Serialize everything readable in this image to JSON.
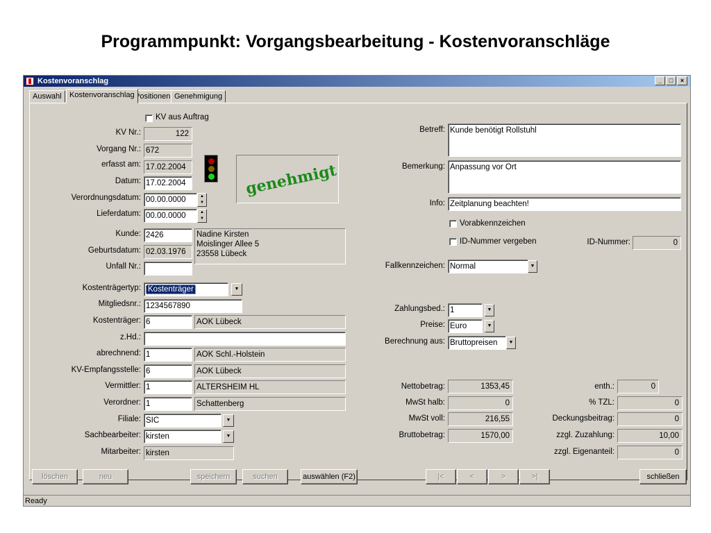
{
  "slide": {
    "title": "Programmpunkt: Vorgangsbearbeitung - Kostenvoranschläge"
  },
  "window": {
    "title": "Kostenvoranschlag",
    "min": "_",
    "max": "□",
    "close": "×"
  },
  "tabs": [
    {
      "label": "Auswahl"
    },
    {
      "label": "Kostenvoranschlag"
    },
    {
      "label": "Positionen"
    },
    {
      "label": "Genehmigung"
    }
  ],
  "left": {
    "kv_aus_auftrag": "KV aus Auftrag",
    "kv_nr": {
      "label": "KV Nr.:",
      "value": "122"
    },
    "vorgang_nr": {
      "label": "Vorgang Nr.:",
      "value": "672"
    },
    "erfasst_am": {
      "label": "erfasst am:",
      "value": "17.02.2004"
    },
    "datum": {
      "label": "Datum:",
      "value": "17.02.2004"
    },
    "verordnungsdatum": {
      "label": "Verordnungsdatum:",
      "value": "00.00.0000"
    },
    "lieferdatum": {
      "label": "Lieferdatum:",
      "value": "00.00.0000"
    },
    "kunde": {
      "label": "Kunde:",
      "value": "2426",
      "name": "Nadine Kirsten",
      "street": "Moislinger Allee 5",
      "city": "23558 Lübeck"
    },
    "geburtsdatum": {
      "label": "Geburtsdatum:",
      "value": "02.03.1976"
    },
    "unfall_nr": {
      "label": "Unfall Nr.:",
      "value": ""
    },
    "kostentraegertyp": {
      "label": "Kostenträgertyp:",
      "value": "Kostenträger"
    },
    "mitgliedsnr": {
      "label": "Mitgliedsnr.:",
      "value": "1234567890"
    },
    "kostentraeger": {
      "label": "Kostenträger:",
      "value": "6",
      "name": "AOK Lübeck"
    },
    "zhd": {
      "label": "z.Hd.:",
      "value": ""
    },
    "abrechnend": {
      "label": "abrechnend:",
      "value": "1",
      "name": "AOK Schl.-Holstein"
    },
    "kv_empfangsstelle": {
      "label": "KV-Empfangsstelle:",
      "value": "6",
      "name": "AOK Lübeck"
    },
    "vermittler": {
      "label": "Vermittler:",
      "value": "1",
      "name": "ALTERSHEIM HL"
    },
    "verordner": {
      "label": "Verordner:",
      "value": "1",
      "name": "Schattenberg"
    },
    "filiale": {
      "label": "Filiale:",
      "value": "SIC"
    },
    "sachbearbeiter": {
      "label": "Sachbearbeiter:",
      "value": "kirsten"
    },
    "mitarbeiter": {
      "label": "Mitarbeiter:",
      "value": "kirsten"
    }
  },
  "status_stamp": "genehmigt",
  "right": {
    "betreff": {
      "label": "Betreff:",
      "value": "Kunde benötigt Rollstuhl"
    },
    "bemerkung": {
      "label": "Bemerkung:",
      "value": "Anpassung vor Ort"
    },
    "info": {
      "label": "Info:",
      "value": "Zeitplanung beachten!"
    },
    "vorabkennzeichen": "Vorabkennzeichen",
    "id_nummer_vergeben": "ID-Nummer vergeben",
    "id_nummer": {
      "label": "ID-Nummer:",
      "value": "0"
    },
    "fallkennzeichen": {
      "label": "Fallkennzeichen:",
      "value": "Normal"
    },
    "zahlungsbed": {
      "label": "Zahlungsbed.:",
      "value": "1"
    },
    "preise": {
      "label": "Preise:",
      "value": "Euro"
    },
    "berechnung_aus": {
      "label": "Berechnung aus:",
      "value": "Bruttopreisen"
    },
    "nettobetrag": {
      "label": "Nettobetrag:",
      "value": "1353,45"
    },
    "mwst_halb": {
      "label": "MwSt halb:",
      "value": "0"
    },
    "mwst_voll": {
      "label": "MwSt voll:",
      "value": "216,55"
    },
    "bruttobetrag": {
      "label": "Bruttobetrag:",
      "value": "1570,00"
    },
    "enth": {
      "label": "enth.:",
      "value": "0"
    },
    "tzl": {
      "label": "% TZL:",
      "value": "0"
    },
    "deckungsbeitrag": {
      "label": "Deckungsbeitrag:",
      "value": "0"
    },
    "zzgl_zuzahlung": {
      "label": "zzgl. Zuzahlung:",
      "value": "10,00"
    },
    "zzgl_eigenanteil": {
      "label": "zzgl. Eigenanteil:",
      "value": "0"
    }
  },
  "buttons": {
    "loeschen": "löschen",
    "neu": "neu",
    "speichern": "speichern",
    "suchen": "suchen",
    "auswaehlen": "auswählen (F2)",
    "first": "|<",
    "prev": "<",
    "next": ">",
    "last": ">|",
    "schliessen": "schließen"
  },
  "statusbar": "Ready"
}
